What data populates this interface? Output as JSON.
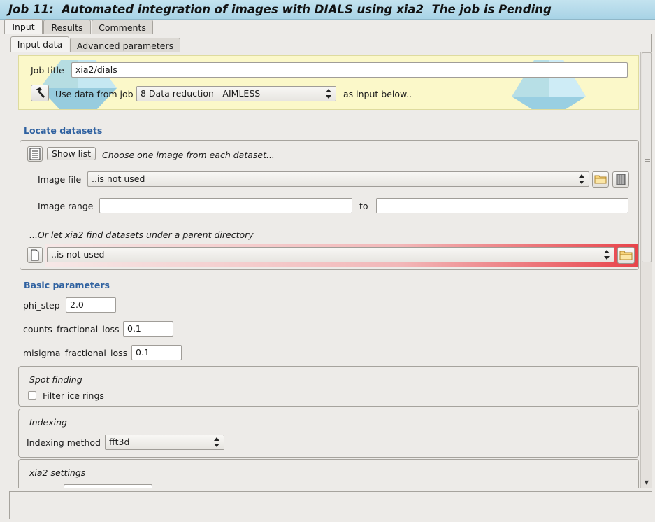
{
  "title": "Job 11:  Automated integration of images with DIALS using xia2  The job is Pending",
  "main_tabs": [
    "Input",
    "Results",
    "Comments"
  ],
  "sub_tabs": [
    "Input data",
    "Advanced parameters"
  ],
  "header": {
    "job_title_label": "Job title",
    "job_title_value": "xia2/dials",
    "use_data_label": "Use data from job",
    "use_data_value": "8 Data reduction - AIMLESS",
    "as_input_label": "as input below.."
  },
  "locate": {
    "title": "Locate datasets",
    "show_list_label": "Show list",
    "choose_hint": "Choose one image from each dataset...",
    "image_file_label": "Image file",
    "image_file_value": "..is not used",
    "image_range_label": "Image range",
    "image_range_from": "",
    "to_label": "to",
    "image_range_to": "",
    "parent_dir_hint": "...Or let xia2 find datasets under a parent directory",
    "parent_dir_value": "..is not used"
  },
  "basic": {
    "title": "Basic parameters",
    "phi_step_label": "phi_step",
    "phi_step_value": "2.0",
    "counts_label": "counts_fractional_loss",
    "counts_value": "0.1",
    "misigma_label": "misigma_fractional_loss",
    "misigma_value": "0.1"
  },
  "spot_finding": {
    "title": "Spot finding",
    "filter_ice_label": "Filter ice rings",
    "filter_ice_checked": false
  },
  "indexing": {
    "title": "Indexing",
    "method_label": "Indexing method",
    "method_value": "fft3d"
  },
  "xia2_settings": {
    "title": "xia2 settings"
  },
  "colors": {
    "section_title": "#2f61a0",
    "highlight_red": "#e8434a",
    "title_bar": "#b5dbeb",
    "yellow_box": "#fbf8c9"
  },
  "icons": [
    "hammer-icon",
    "list-icon",
    "folder-icon",
    "database-icon",
    "file-icon"
  ]
}
